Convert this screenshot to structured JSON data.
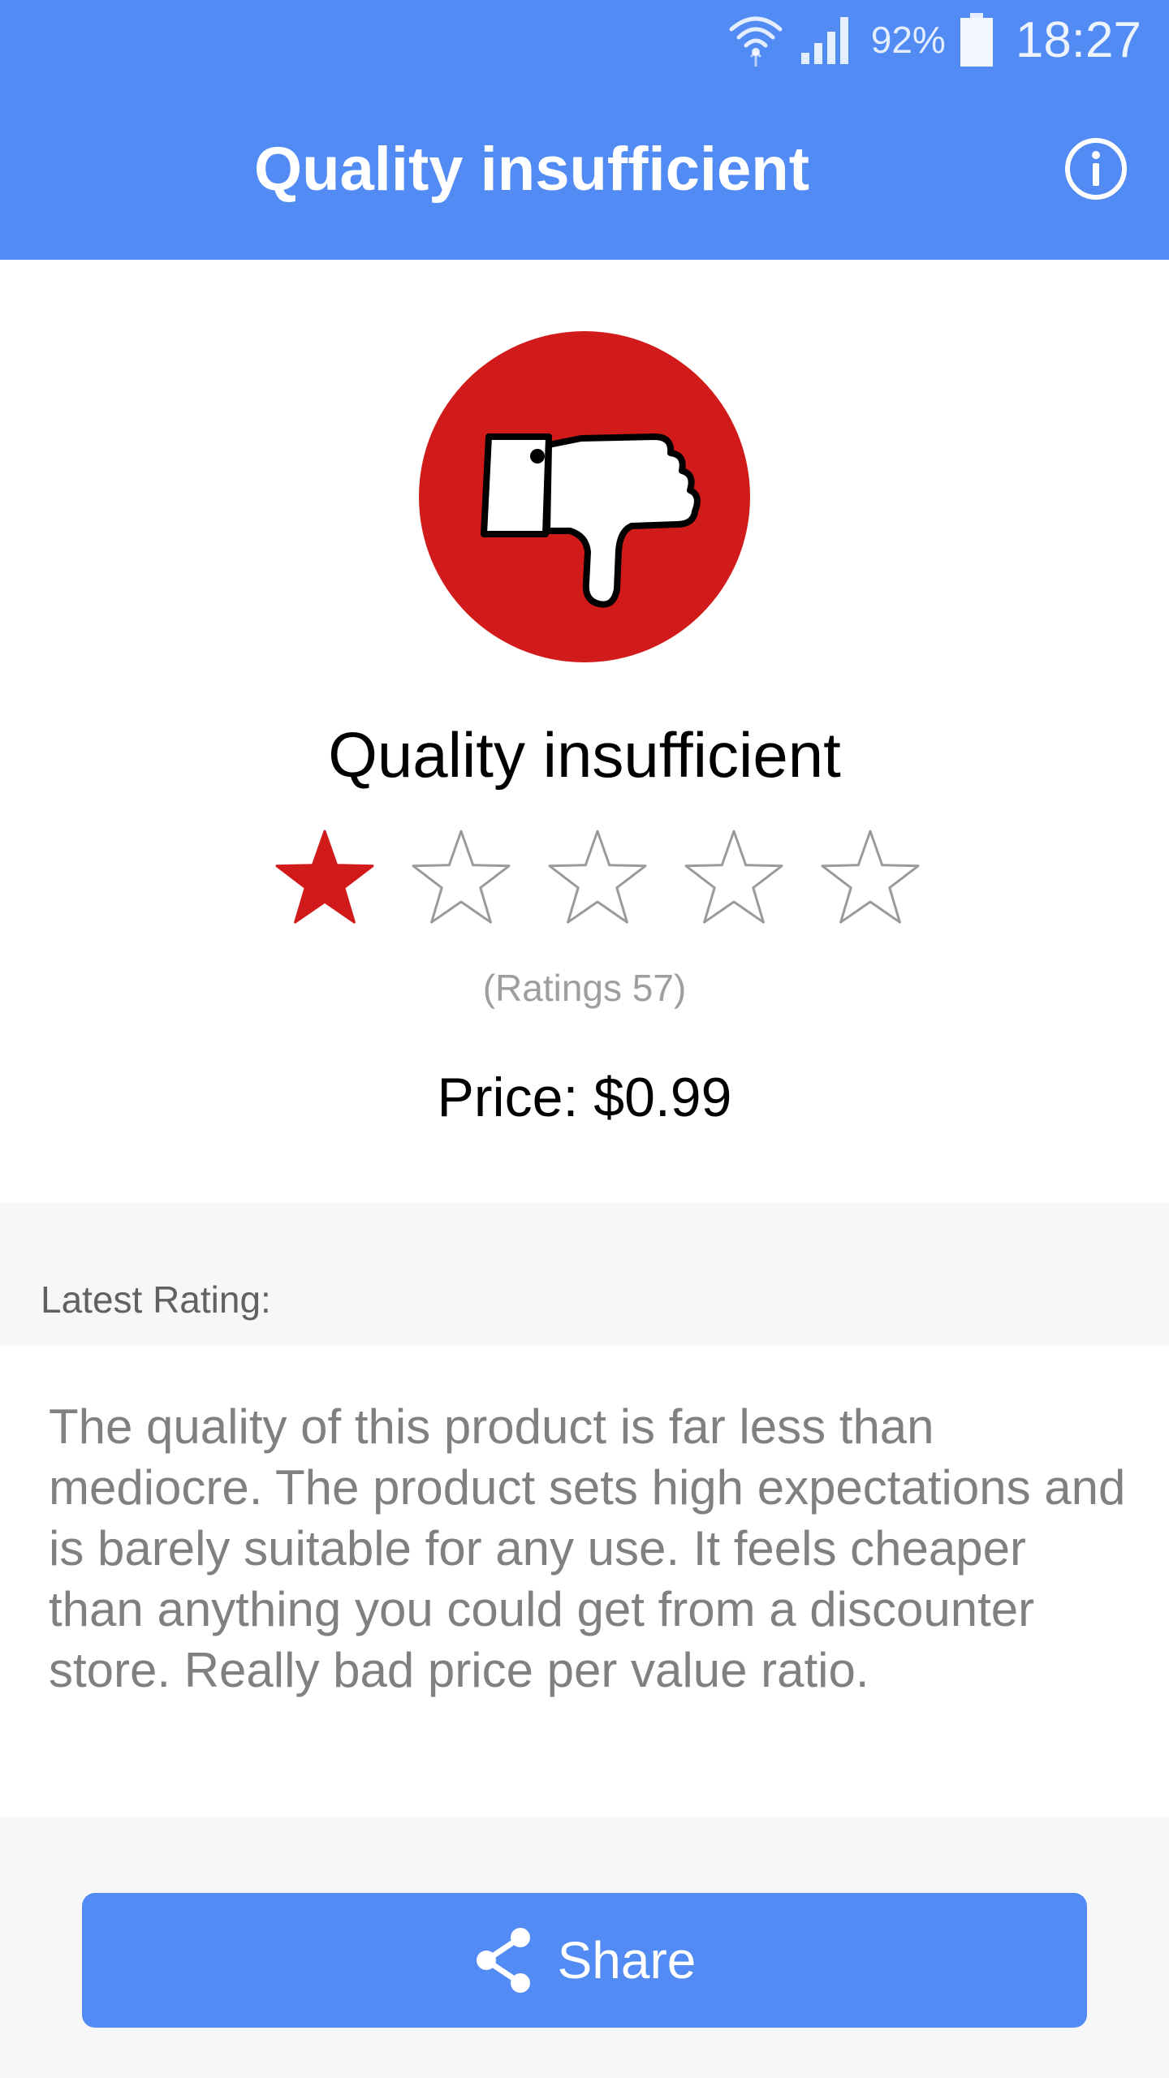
{
  "status_bar": {
    "battery_percent": "92%",
    "time": "18:27",
    "icons": [
      "wifi-icon",
      "signal-icon",
      "battery-icon"
    ]
  },
  "app_bar": {
    "title": "Quality insufficient",
    "info_icon": "info-icon"
  },
  "product": {
    "icon": "thumbs-down-icon",
    "title": "Quality insufficient",
    "rating": {
      "value": 1,
      "max": 5
    },
    "ratings_count": "(Ratings 57)",
    "price": "Price: $0.99"
  },
  "latest_rating": {
    "label": "Latest Rating:",
    "text": "The quality of this product is far less than mediocre. The product sets high expectations and is barely suitable for any use. It feels cheaper than anything you could get from a discounter store. Really bad price per value ratio."
  },
  "actions": {
    "share_label": "Share",
    "share_icon": "share-icon"
  },
  "colors": {
    "primary": "#528bf4",
    "accent_red": "#d11a1a",
    "muted_text": "#808080",
    "background_gray": "#f7f7f7"
  }
}
